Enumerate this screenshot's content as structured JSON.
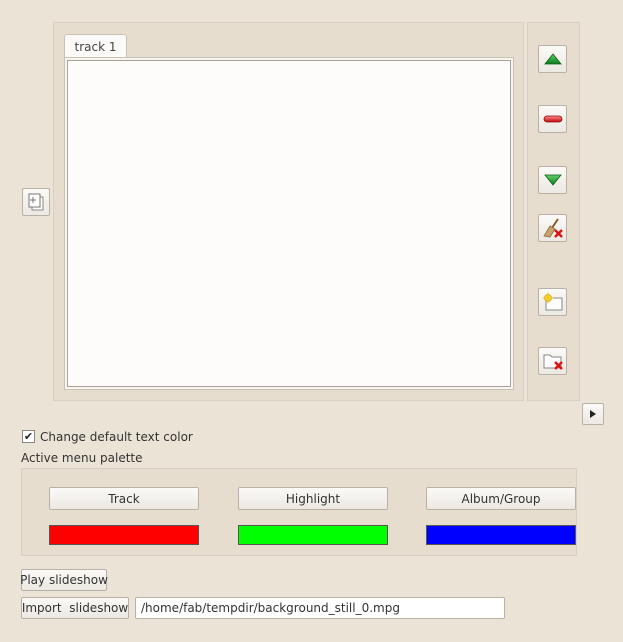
{
  "tracks": {
    "tabs": [
      {
        "label": "track 1"
      }
    ]
  },
  "side_buttons": [
    {
      "name": "move-up-button",
      "icon": "green-up-arrow-icon"
    },
    {
      "name": "remove-button",
      "icon": "red-minus-icon"
    },
    {
      "name": "move-down-button",
      "icon": "green-down-arrow-icon"
    },
    {
      "name": "clear-button",
      "icon": "broom-delete-icon"
    },
    {
      "name": "add-folder-button",
      "icon": "folder-new-icon"
    },
    {
      "name": "delete-folder-button",
      "icon": "folder-delete-icon"
    }
  ],
  "options": {
    "change_text_color": {
      "label": "Change default text color",
      "checked": true,
      "mark": "✔"
    },
    "palette_title": "Active menu palette"
  },
  "palette": {
    "items": [
      {
        "label": "Track",
        "color": "#ff0000"
      },
      {
        "label": "Highlight",
        "color": "#00ff00"
      },
      {
        "label": "Album/Group",
        "color": "#0000ff"
      }
    ]
  },
  "bottom": {
    "play_label": "Play slideshow",
    "import_label": "Import  slideshow",
    "path_value": "/home/fab/tempdir/background_still_0.mpg"
  },
  "colors": {
    "background": "#ebe3d5"
  }
}
